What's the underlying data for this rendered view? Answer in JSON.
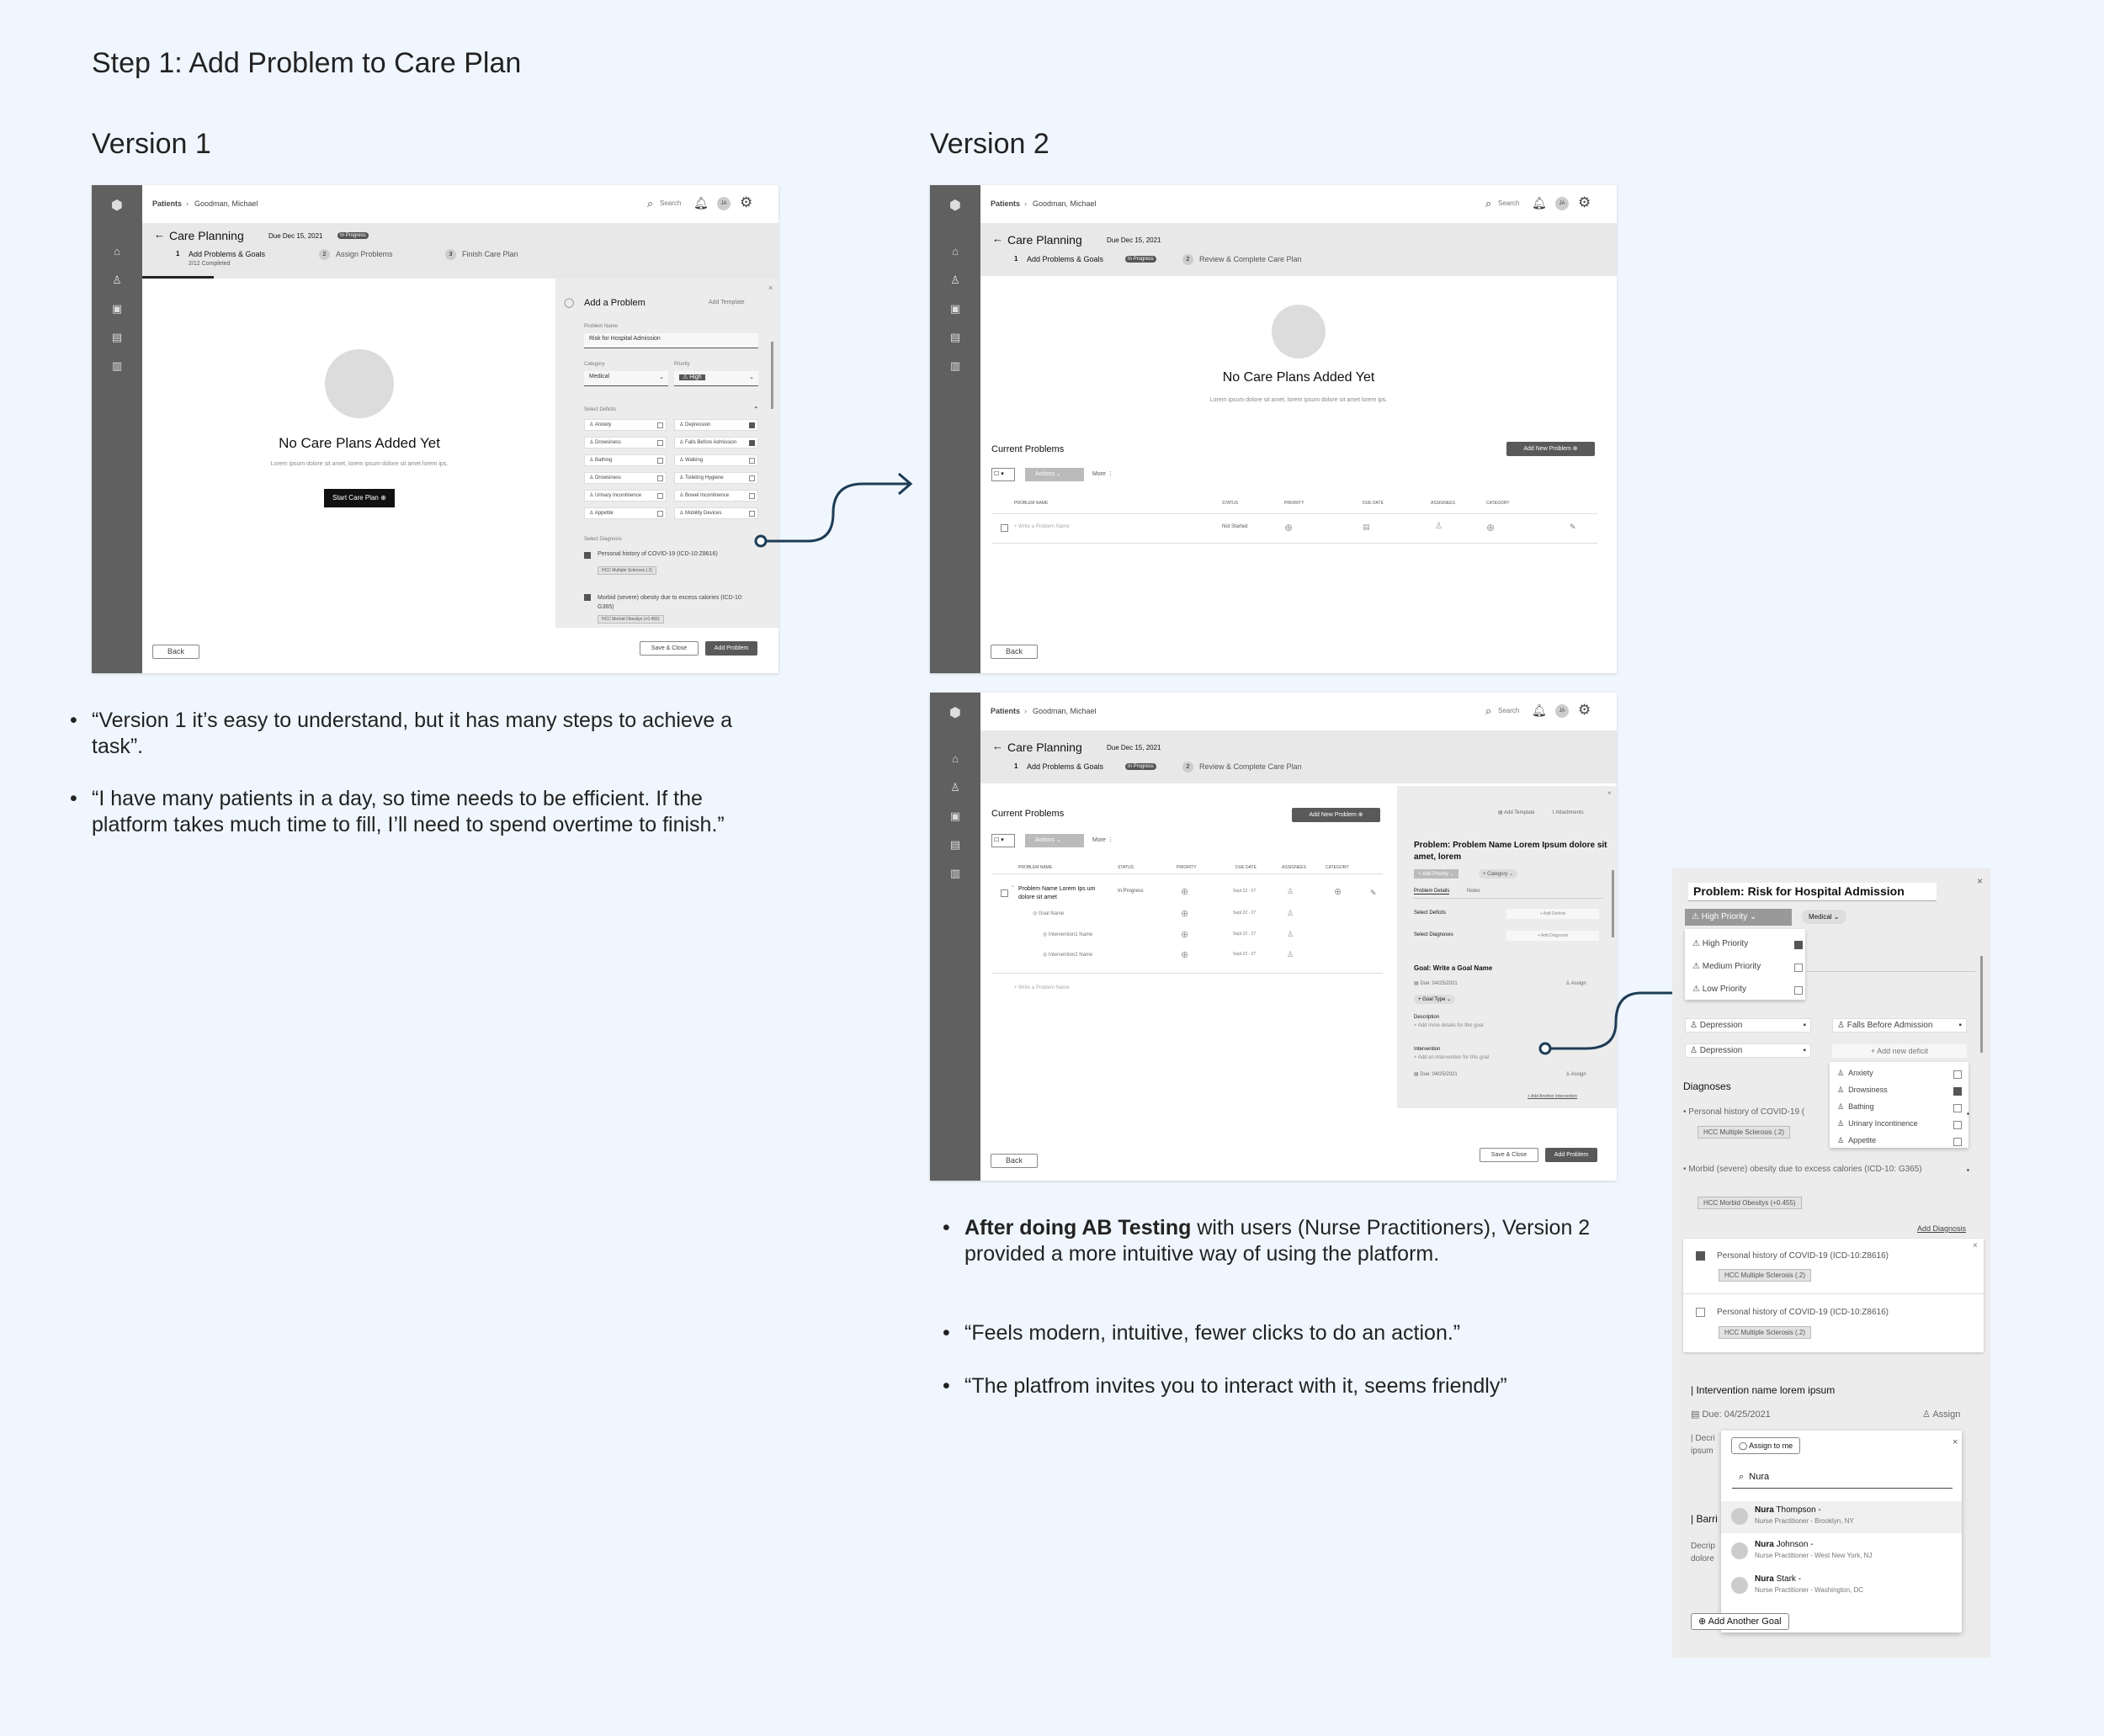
{
  "page": {
    "title": "Step 1: Add Problem to Care Plan",
    "version1_title": "Version 1",
    "version2_title": "Version 2"
  },
  "app": {
    "breadcrumb_root": "Patients",
    "breadcrumb_patient": "Goodman, Michael",
    "search": "Search",
    "avatar": "JA",
    "care_planning": "Care Planning",
    "due": "Due Dec 15, 2021",
    "in_progress": "In Progress",
    "back": "Back",
    "save_close": "Save & Close",
    "add_problem": "Add Problem",
    "no_plans_title": "No Care Plans Added Yet",
    "no_plans_sub": "Lorem ipsum dolore sit amet, lorem ipsum dolore sit amet lorem ips."
  },
  "v1": {
    "steps": [
      {
        "num": "1",
        "label": "Add Problems & Goals",
        "sub": "2/12 Completed"
      },
      {
        "num": "2",
        "label": "Assign Problems"
      },
      {
        "num": "3",
        "label": "Finish Care Plan"
      }
    ],
    "start_button": "Start Care Plan",
    "panel": {
      "title": "Add a Problem",
      "add_template": "Add Template",
      "problem_name_label": "Problem Name",
      "problem_name_value": "Risk for Hospital Admission",
      "category_label": "Category",
      "category_value": "Medical",
      "priority_label": "Priority",
      "priority_value": "High",
      "deficits_label": "Select Deficits",
      "deficits_left": [
        "Anxiety",
        "Drowsiness",
        "Bathing",
        "Drowsiness",
        "Urinary Incontinence",
        "Appetite"
      ],
      "deficits_right": [
        "Depression",
        "Falls Before Admission",
        "Walking",
        "Toileting Hygiene",
        "Bowel Incontinence",
        "Mobility Devices"
      ],
      "diagnosis_label": "Select Diagnosis",
      "diag1": "Personal history of COVID-19 (ICD-10:Z8616)",
      "diag1_tag": "HCC Multiple Sclerosis (.2)",
      "diag2": "Morbid (severe) obesity due to excess calories (ICD-10: G365)",
      "diag2_tag": "HCC Morbid Obesitys (+0.455)"
    }
  },
  "v2": {
    "steps": [
      {
        "num": "1",
        "label": "Add Problems & Goals"
      },
      {
        "num": "2",
        "label": "Review & Complete Care Plan"
      }
    ],
    "current_problems": "Current Problems",
    "add_new_problem": "Add New Problem",
    "actions": "Actions",
    "more": "More",
    "columns": [
      "PROBLEM NAME",
      "STATUS",
      "PRIORITY",
      "DUE DATE",
      "ASSIGNEES",
      "CATEGORY"
    ],
    "write_problem": "+ Write a Problem Name",
    "not_started": "Not Started",
    "row_problem": "Problem Name Lorem Ips um dolore sit amet",
    "goal_name": "Goal Name",
    "intervention1": "Intervention1 Name",
    "intervention2": "Intervention2 Name",
    "date": "Sept 22 - 27",
    "panel": {
      "add_template": "Add Template",
      "attachments": "Attachments",
      "problem_title": "Problem: Problem Name Lorem Ipsum dolore sit amet, lorem",
      "add_priority": "Add Priority",
      "category": "Category",
      "tab_details": "Problem Details",
      "tab_notes": "Notes",
      "select_deficits": "Select Deficits",
      "add_deficits": "+ Add Deficits",
      "select_diagnoses": "Select Diagnoses",
      "add_diagnosis": "+ Add Diagnosis",
      "goal_title": "Goal: Write a Goal Name",
      "due": "Due: 04/25/2021",
      "assign": "Assign",
      "goal_type": "Goal Type",
      "description": "Description",
      "add_details": "+ Add more details for this goal",
      "intervention": "Intervention",
      "add_intervention": "+ Add an intervention for this goal",
      "add_another_intervention": "+ Add Another Intervention"
    }
  },
  "detail": {
    "problem_title": "Problem: Risk for Hospital Admission",
    "priority_selected": "High Priority",
    "category": "Medical",
    "priorities": [
      "High Priority",
      "Medium Priority",
      "Low Priority"
    ],
    "falls": "Falls Before Admission",
    "depression": "Depression",
    "add_new_deficit": "+ Add new deficit",
    "deficit_list": [
      "Anxiety",
      "Drowsiness",
      "Bathing",
      "Urinary Incontinence",
      "Appetite"
    ],
    "diagnoses": "Diagnoses",
    "diag1_short": "Personal history of COVID-19 (",
    "diag_tag1": "HCC Multiple Sclerosis (.2)",
    "diag2": "Morbid (severe) obesity due to excess calories (ICD-10: G365)",
    "diag_tag2": "HCC Morbid Obesitys (+0.455)",
    "add_diagnosis": "Add Diagnosis",
    "card1": "Personal history of COVID-19 (ICD-10:Z8616)",
    "card2": "Personal history of COVID-19 (ICD-10:Z8616)",
    "intervention_name": "| Intervention name lorem ipsum",
    "due": "Due: 04/25/2021",
    "assign": "Assign",
    "decri": "| Decri",
    "ipsum": "ipsum",
    "barri": "| Barri",
    "decrip": "Decrip",
    "dolore": "dolore",
    "assign_to_me": "Assign to me",
    "search_value": "Nura",
    "people": [
      {
        "first": "Nura",
        "last": " Thompson -",
        "role": "Nurse Practitioner - Brooklyn, NY"
      },
      {
        "first": "Nura",
        "last": " Johnson -",
        "role": "Nurse Practitioner - West New York, NJ"
      },
      {
        "first": "Nura",
        "last": " Stark -",
        "role": "Nurse Practitioner - Washington, DC"
      }
    ],
    "add_another_goal": "Add Another Goal"
  },
  "feedback": {
    "v1_quotes": [
      "“Version 1 it’s easy to understand, but it has many steps to achieve a task”.",
      "“I have many patients in a day, so time needs to be efficient. If the platform takes much time to fill, I’ll need to spend overtime to finish.”"
    ],
    "v2_bold": "After doing AB Testing",
    "v2_rest": " with users (Nurse Practitioners), Version 2 provided a more intuitive way of using the platform.",
    "v2_quotes": [
      "“Feels modern, intuitive, fewer clicks to do an action.”",
      "“The platfrom invites you to interact with it, seems friendly”"
    ]
  },
  "colors": {
    "background": "#eff6fd",
    "sidebar": "#606060",
    "connector": "#1d3c56"
  }
}
